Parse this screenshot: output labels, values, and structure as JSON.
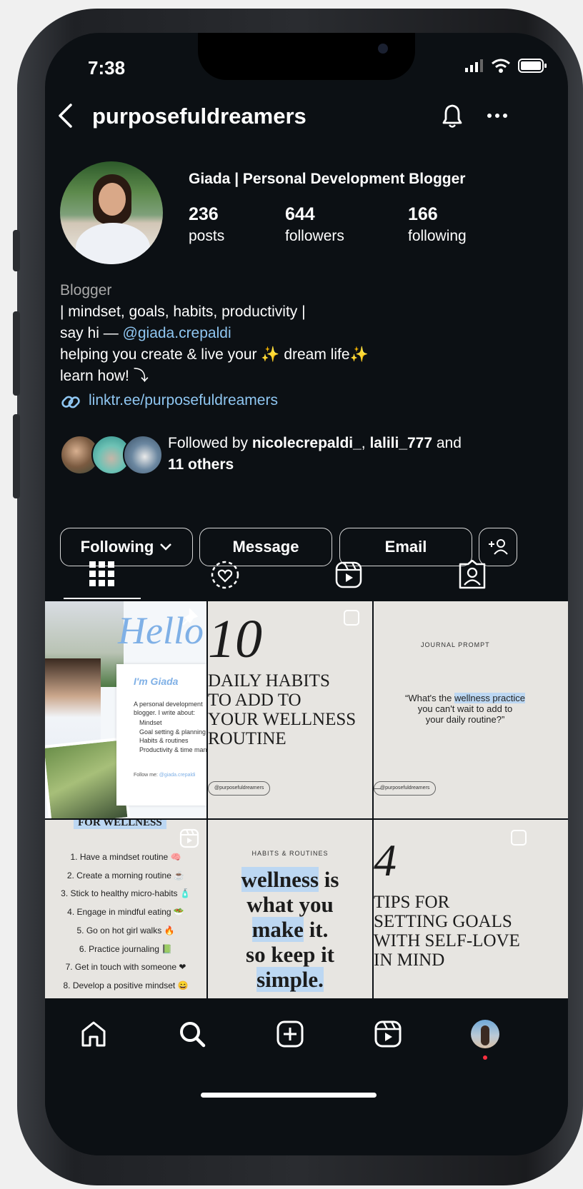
{
  "status_bar": {
    "time": "7:38"
  },
  "header": {
    "username": "purposefuldreamers"
  },
  "profile": {
    "name": "Giada | Personal Development Blogger",
    "stats": [
      {
        "value": "236",
        "label": "posts"
      },
      {
        "value": "644",
        "label": "followers"
      },
      {
        "value": "166",
        "label": "following"
      }
    ],
    "category": "Blogger",
    "bio_line1": "| mindset, goals, habits, productivity |",
    "bio_line2_prefix": "say hi — ",
    "bio_line2_handle": "@giada.crepaldi",
    "bio_line3_a": "helping you create & live your ",
    "bio_line3_b": " dream life",
    "bio_line4": "learn how! ⤵",
    "sparkle": "✨",
    "link": "linktr.ee/purposefuldreamers",
    "followed_by_prefix": "Followed by ",
    "followed_by_users": "nicolecrepaldi_",
    "followed_by_sep": ", ",
    "followed_by_users2": "lalili_777",
    "followed_by_and": " and",
    "followed_by_others": "11 others"
  },
  "actions": {
    "following": "Following",
    "message": "Message",
    "email": "Email"
  },
  "posts": {
    "p1": {
      "hello": "Hello!",
      "intro_title": "I'm Giada",
      "intro_text": "A personal development blogger. I write about:",
      "bullets": [
        "Mindset",
        "Goal setting & planning",
        "Habits & routines",
        "Productivity & time management"
      ],
      "follow_label": "Follow me: ",
      "follow_handle": "@giada.crepaldi"
    },
    "p2": {
      "number": "10",
      "lines": [
        "DAILY HABITS",
        "TO ADD TO",
        "YOUR WELLNESS",
        "ROUTINE"
      ],
      "handle": "@purposefuldreamers"
    },
    "p3": {
      "label": "JOURNAL PROMPT",
      "quote_a": "“What's the ",
      "quote_b": "wellness practice",
      "quote_c": "you can't wait to add to",
      "quote_d": "your daily routine?”",
      "handle": "@purposefuldreamers"
    },
    "p4": {
      "header": "FOR WELLNESS",
      "items": [
        "1. Have a mindset routine 🧠",
        "2. Create a morning routine ☕",
        "3. Stick to healthy micro-habits 🧴",
        "4. Engage in mindful eating 🥗",
        "5. Go on hot girl walks 🔥",
        "6. Practice journaling 📗",
        "7. Get in touch with someone ❤",
        "8. Develop a positive mindset 😄"
      ]
    },
    "p5": {
      "label": "HABITS & ROUTINES",
      "l1a": "wellness",
      "l1b": " is",
      "l2": "what you",
      "l3a": "make",
      "l3b": " it.",
      "l4": "so keep it",
      "l5": "simple."
    },
    "p6": {
      "number": "4",
      "lines": [
        "TIPS FOR",
        "SETTING GOALS",
        "WITH SELF-LOVE",
        "IN MIND"
      ]
    }
  },
  "colors": {
    "background": "#0c1014",
    "link": "#8fc6f1",
    "highlight": "#bcd7f2",
    "notification_dot": "#ff3040"
  }
}
